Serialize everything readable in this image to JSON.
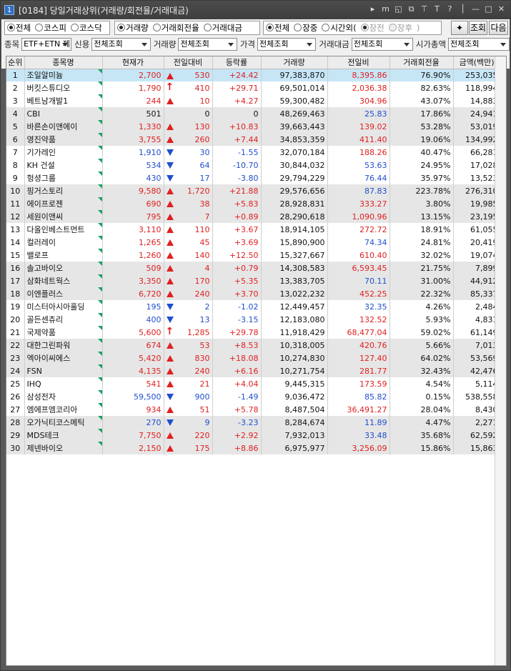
{
  "window": {
    "num": "1",
    "title": "[0184] 당일거래상위(거래량/회전율/거래대금)"
  },
  "title_buttons": [
    "▸",
    "m",
    "◱",
    "⧉",
    "⊤",
    "T",
    "?",
    "│",
    "—",
    "□",
    "✕"
  ],
  "radio_group_market": [
    {
      "label": "전체",
      "checked": true
    },
    {
      "label": "코스피",
      "checked": false
    },
    {
      "label": "코스닥",
      "checked": false
    }
  ],
  "radio_group_sort": [
    {
      "label": "거래량",
      "checked": true
    },
    {
      "label": "거래회전율",
      "checked": false
    },
    {
      "label": "거래대금",
      "checked": false
    }
  ],
  "radio_group_session": [
    {
      "label": "전체",
      "checked": true,
      "disabled": false
    },
    {
      "label": "장중",
      "checked": false,
      "disabled": false
    },
    {
      "label": "시간외(",
      "checked": false,
      "disabled": false
    },
    {
      "label": "장전",
      "checked": true,
      "disabled": true
    },
    {
      "label": "장후",
      "checked": false,
      "disabled": true
    },
    {
      "label": ")",
      "checked": null,
      "disabled": true
    }
  ],
  "buttons": {
    "settings": "✦",
    "query": "조회",
    "next": "다음"
  },
  "filters": [
    {
      "label": "종목",
      "value": "ETF+ETN 제"
    },
    {
      "label": "신용",
      "value": "전체조회"
    },
    {
      "label": "거래량",
      "value": "전체조회"
    },
    {
      "label": "가격",
      "value": "전체조회"
    },
    {
      "label": "거래대금",
      "value": "전체조회"
    },
    {
      "label": "시가총액",
      "value": "전체조회"
    }
  ],
  "columns": [
    "순위",
    "종목명",
    "현재가",
    "전일대비",
    "등락률",
    "거래량",
    "전일비",
    "거래회전율",
    "금액(백만)"
  ],
  "rows": [
    {
      "rank": "1",
      "name": "조일알미늄",
      "price": "2,700",
      "sym": "up",
      "chg": "530",
      "rate": "+24.42",
      "vol": "97,383,870",
      "ratio": "8,395.86",
      "turn": "76.90%",
      "amt": "253,035",
      "pc": "red",
      "rc": "red",
      "sel": true
    },
    {
      "rank": "2",
      "name": "버킷스튜디오",
      "price": "1,790",
      "sym": "limit",
      "chg": "410",
      "rate": "+29.71",
      "vol": "69,501,014",
      "ratio": "2,036.38",
      "turn": "82.63%",
      "amt": "118,994",
      "pc": "red",
      "rc": "red"
    },
    {
      "rank": "3",
      "name": "베트남개발1",
      "price": "244",
      "sym": "up",
      "chg": "10",
      "rate": "+4.27",
      "vol": "59,300,482",
      "ratio": "304.96",
      "turn": "43.07%",
      "amt": "14,883",
      "pc": "red",
      "rc": "red"
    },
    {
      "rank": "4",
      "name": "CBI",
      "price": "501",
      "sym": "none",
      "chg": "0",
      "rate": "0",
      "vol": "48,269,463",
      "ratio": "25.83",
      "turn": "17.86%",
      "amt": "24,941",
      "pc": "blk",
      "rc": "blue"
    },
    {
      "rank": "5",
      "name": "바른손이앤에이",
      "price": "1,330",
      "sym": "up",
      "chg": "130",
      "rate": "+10.83",
      "vol": "39,663,443",
      "ratio": "139.02",
      "turn": "53.28%",
      "amt": "53,019",
      "pc": "red",
      "rc": "red"
    },
    {
      "rank": "6",
      "name": "영진약품",
      "price": "3,755",
      "sym": "up",
      "chg": "260",
      "rate": "+7.44",
      "vol": "34,853,359",
      "ratio": "411.40",
      "turn": "19.06%",
      "amt": "134,992",
      "pc": "red",
      "rc": "red"
    },
    {
      "rank": "7",
      "name": "기가레인",
      "price": "1,910",
      "sym": "down",
      "chg": "30",
      "rate": "-1.55",
      "vol": "32,070,184",
      "ratio": "188.26",
      "turn": "40.47%",
      "amt": "66,281",
      "pc": "blue",
      "rc": "red"
    },
    {
      "rank": "8",
      "name": "KH 건설",
      "price": "534",
      "sym": "down",
      "chg": "64",
      "rate": "-10.70",
      "vol": "30,844,032",
      "ratio": "53.63",
      "turn": "24.95%",
      "amt": "17,028",
      "pc": "blue",
      "rc": "blue"
    },
    {
      "rank": "9",
      "name": "헝셩그룹",
      "price": "430",
      "sym": "down",
      "chg": "17",
      "rate": "-3.80",
      "vol": "29,794,229",
      "ratio": "76.44",
      "turn": "35.97%",
      "amt": "13,523",
      "pc": "blue",
      "rc": "blue"
    },
    {
      "rank": "10",
      "name": "핑거스토리",
      "price": "9,580",
      "sym": "up",
      "chg": "1,720",
      "rate": "+21.88",
      "vol": "29,576,656",
      "ratio": "87.83",
      "turn": "223.78%",
      "amt": "276,310",
      "pc": "red",
      "rc": "blue"
    },
    {
      "rank": "11",
      "name": "에이프로젠",
      "price": "690",
      "sym": "up",
      "chg": "38",
      "rate": "+5.83",
      "vol": "28,928,831",
      "ratio": "333.27",
      "turn": "3.80%",
      "amt": "19,985",
      "pc": "red",
      "rc": "red"
    },
    {
      "rank": "12",
      "name": "세원이앤씨",
      "price": "795",
      "sym": "up",
      "chg": "7",
      "rate": "+0.89",
      "vol": "28,290,618",
      "ratio": "1,090.96",
      "turn": "13.15%",
      "amt": "23,195",
      "pc": "red",
      "rc": "red"
    },
    {
      "rank": "13",
      "name": "다올인베스트먼트",
      "price": "3,110",
      "sym": "up",
      "chg": "110",
      "rate": "+3.67",
      "vol": "18,914,105",
      "ratio": "272.72",
      "turn": "18.91%",
      "amt": "61,055",
      "pc": "red",
      "rc": "red"
    },
    {
      "rank": "14",
      "name": "컬러레이",
      "price": "1,265",
      "sym": "up",
      "chg": "45",
      "rate": "+3.69",
      "vol": "15,890,900",
      "ratio": "74.34",
      "turn": "24.81%",
      "amt": "20,419",
      "pc": "red",
      "rc": "blue"
    },
    {
      "rank": "15",
      "name": "밸로프",
      "price": "1,260",
      "sym": "up",
      "chg": "140",
      "rate": "+12.50",
      "vol": "15,327,667",
      "ratio": "610.40",
      "turn": "32.02%",
      "amt": "19,074",
      "pc": "red",
      "rc": "red"
    },
    {
      "rank": "16",
      "name": "솔고바이오",
      "price": "509",
      "sym": "up",
      "chg": "4",
      "rate": "+0.79",
      "vol": "14,308,583",
      "ratio": "6,593.45",
      "turn": "21.75%",
      "amt": "7,899",
      "pc": "red",
      "rc": "red"
    },
    {
      "rank": "17",
      "name": "삼화네트웍스",
      "price": "3,350",
      "sym": "up",
      "chg": "170",
      "rate": "+5.35",
      "vol": "13,383,705",
      "ratio": "70.11",
      "turn": "31.00%",
      "amt": "44,912",
      "pc": "red",
      "rc": "blue"
    },
    {
      "rank": "18",
      "name": "이엔플러스",
      "price": "6,720",
      "sym": "up",
      "chg": "240",
      "rate": "+3.70",
      "vol": "13,022,232",
      "ratio": "452.25",
      "turn": "22.32%",
      "amt": "85,337",
      "pc": "red",
      "rc": "red"
    },
    {
      "rank": "19",
      "name": "미스터아시아홀딩",
      "price": "195",
      "sym": "down",
      "chg": "2",
      "rate": "-1.02",
      "vol": "12,449,457",
      "ratio": "32.35",
      "turn": "4.26%",
      "amt": "2,484",
      "pc": "blue",
      "rc": "blue"
    },
    {
      "rank": "20",
      "name": "골든센츄리",
      "price": "400",
      "sym": "down",
      "chg": "13",
      "rate": "-3.15",
      "vol": "12,183,080",
      "ratio": "132.52",
      "turn": "5.93%",
      "amt": "4,831",
      "pc": "blue",
      "rc": "red"
    },
    {
      "rank": "21",
      "name": "국제약품",
      "price": "5,600",
      "sym": "limit",
      "chg": "1,285",
      "rate": "+29.78",
      "vol": "11,918,429",
      "ratio": "68,477.04",
      "turn": "59.02%",
      "amt": "61,149",
      "pc": "red",
      "rc": "red"
    },
    {
      "rank": "22",
      "name": "대한그린파워",
      "price": "674",
      "sym": "up",
      "chg": "53",
      "rate": "+8.53",
      "vol": "10,318,005",
      "ratio": "420.76",
      "turn": "5.66%",
      "amt": "7,013",
      "pc": "red",
      "rc": "red"
    },
    {
      "rank": "23",
      "name": "엑아이씨에스",
      "price": "5,420",
      "sym": "up",
      "chg": "830",
      "rate": "+18.08",
      "vol": "10,274,830",
      "ratio": "127.40",
      "turn": "64.02%",
      "amt": "53,569",
      "pc": "red",
      "rc": "red"
    },
    {
      "rank": "24",
      "name": "FSN",
      "price": "4,135",
      "sym": "up",
      "chg": "240",
      "rate": "+6.16",
      "vol": "10,271,754",
      "ratio": "281.77",
      "turn": "32.43%",
      "amt": "42,476",
      "pc": "red",
      "rc": "red"
    },
    {
      "rank": "25",
      "name": "IHQ",
      "price": "541",
      "sym": "up",
      "chg": "21",
      "rate": "+4.04",
      "vol": "9,445,315",
      "ratio": "173.59",
      "turn": "4.54%",
      "amt": "5,114",
      "pc": "red",
      "rc": "red"
    },
    {
      "rank": "26",
      "name": "삼성전자",
      "price": "59,500",
      "sym": "down",
      "chg": "900",
      "rate": "-1.49",
      "vol": "9,036,472",
      "ratio": "85.82",
      "turn": "0.15%",
      "amt": "538,558",
      "pc": "blue",
      "rc": "blue"
    },
    {
      "rank": "27",
      "name": "엠에프엠코리아",
      "price": "934",
      "sym": "up",
      "chg": "51",
      "rate": "+5.78",
      "vol": "8,487,504",
      "ratio": "36,491.27",
      "turn": "28.04%",
      "amt": "8,430",
      "pc": "red",
      "rc": "red"
    },
    {
      "rank": "28",
      "name": "오가닉티코스메틱",
      "price": "270",
      "sym": "down",
      "chg": "9",
      "rate": "-3.23",
      "vol": "8,284,674",
      "ratio": "11.89",
      "turn": "4.47%",
      "amt": "2,271",
      "pc": "blue",
      "rc": "blue"
    },
    {
      "rank": "29",
      "name": "MDS테크",
      "price": "7,750",
      "sym": "up",
      "chg": "220",
      "rate": "+2.92",
      "vol": "7,932,013",
      "ratio": "33.48",
      "turn": "35.68%",
      "amt": "62,592",
      "pc": "red",
      "rc": "blue"
    },
    {
      "rank": "30",
      "name": "제넨바이오",
      "price": "2,150",
      "sym": "up",
      "chg": "175",
      "rate": "+8.86",
      "vol": "6,975,977",
      "ratio": "3,256.09",
      "turn": "15.86%",
      "amt": "15,863",
      "pc": "red",
      "rc": "red"
    }
  ],
  "colors": {
    "up": "#e02020",
    "down": "#1f4fcf",
    "selected_row": "#c6e6f6",
    "flag": "#18a060"
  }
}
